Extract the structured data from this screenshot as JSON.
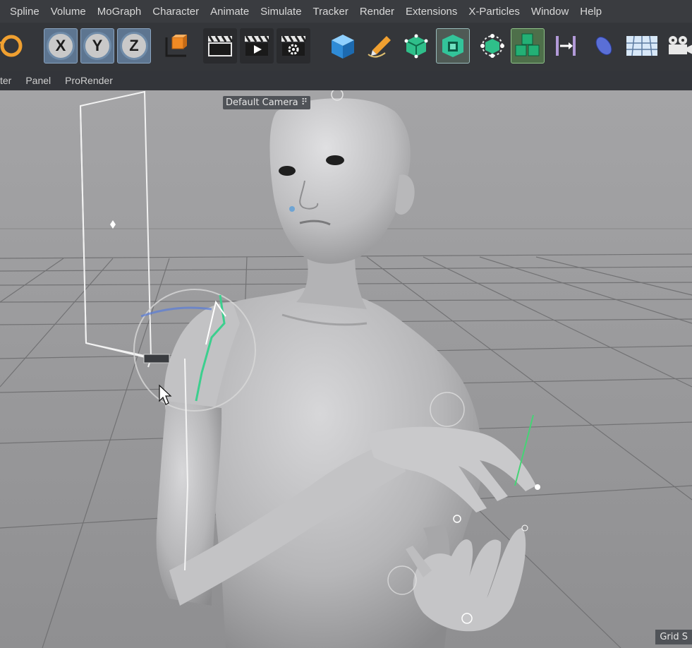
{
  "menubar": {
    "items": [
      "Spline",
      "Volume",
      "MoGraph",
      "Character",
      "Animate",
      "Simulate",
      "Tracker",
      "Render",
      "Extensions",
      "X-Particles",
      "Window",
      "Help"
    ]
  },
  "toolbar": {
    "x_axis": "X",
    "y_axis": "Y",
    "z_axis": "Z",
    "icons": [
      "rotate-lock-icon",
      "x-axis-icon",
      "y-axis-icon",
      "z-axis-icon",
      "coordinate-system-icon",
      "render-view-icon",
      "render-to-picture-viewer-icon",
      "render-settings-icon",
      "cube-icon",
      "pen-spline-icon",
      "subdivision-icon",
      "extrude-nurbs-icon",
      "array-icon",
      "mograph-cloner-icon",
      "deformer-icon",
      "floor-icon",
      "sky-grid-icon",
      "camera-icon"
    ]
  },
  "submenu": {
    "items": [
      "ter",
      "Panel",
      "ProRender"
    ]
  },
  "viewport": {
    "camera_label": "Default Camera",
    "grid_label": "Grid S"
  },
  "colors": {
    "menubar_bg": "#3a3c40",
    "toolbar_bg": "#34363a",
    "viewport_bg": "#9c9c9e",
    "selection_blue": "#5d7590",
    "active_green": "#4e6f4a",
    "rig_green": "#3ccf8e"
  }
}
